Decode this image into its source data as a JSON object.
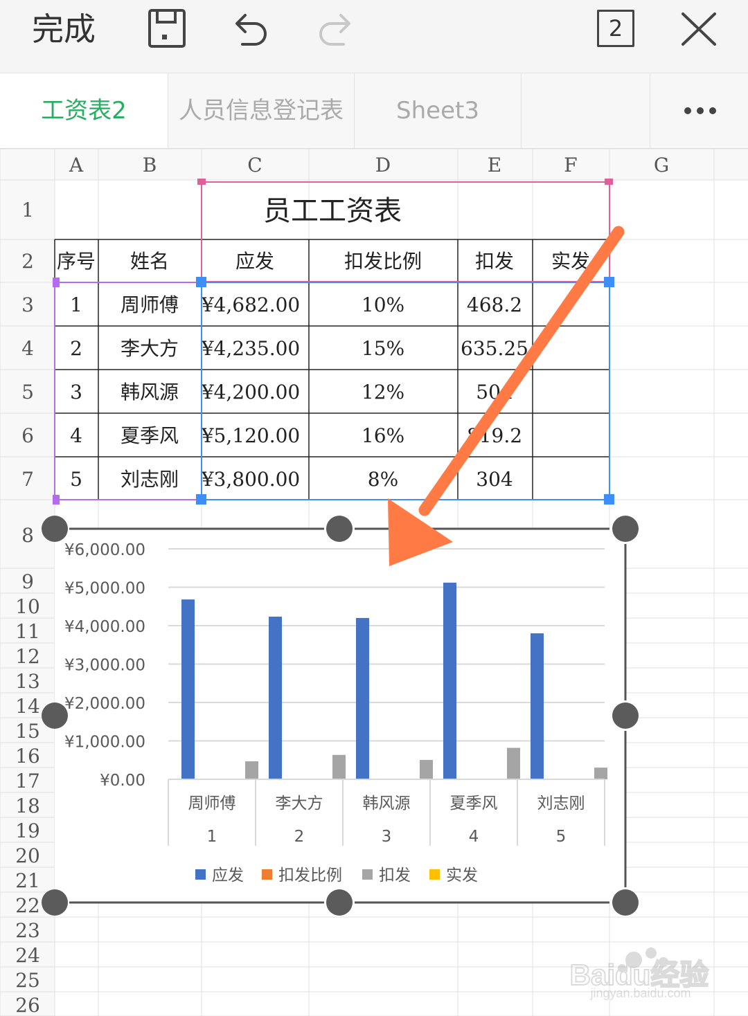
{
  "toolbar": {
    "done_label": "完成",
    "sheet_count": "2"
  },
  "tabs": [
    {
      "label": "工资表2",
      "active": true
    },
    {
      "label": "人员信息登记表",
      "active": false
    },
    {
      "label": "Sheet3",
      "active": false
    }
  ],
  "more_label": "•••",
  "columns": [
    "A",
    "B",
    "C",
    "D",
    "E",
    "F",
    "G"
  ],
  "rows": [
    "1",
    "2",
    "3",
    "4",
    "5",
    "6",
    "7",
    "8",
    "9",
    "10",
    "11",
    "12",
    "13",
    "14",
    "15",
    "16",
    "17",
    "18",
    "19",
    "20",
    "21",
    "22",
    "23",
    "24",
    "25",
    "26"
  ],
  "table": {
    "title": "员工工资表",
    "headers": [
      "序号",
      "姓名",
      "应发",
      "扣发比例",
      "扣发",
      "实发"
    ],
    "records": [
      [
        "1",
        "周师傅",
        "¥4,682.00",
        "10%",
        "468.2",
        ""
      ],
      [
        "2",
        "李大方",
        "¥4,235.00",
        "15%",
        "635.25",
        ""
      ],
      [
        "3",
        "韩风源",
        "¥4,200.00",
        "12%",
        "504",
        ""
      ],
      [
        "4",
        "夏季风",
        "¥5,120.00",
        "16%",
        "819.2",
        ""
      ],
      [
        "5",
        "刘志刚",
        "¥3,800.00",
        "8%",
        "304",
        ""
      ]
    ]
  },
  "chart_data": {
    "type": "bar",
    "title": "",
    "categories": [
      "周师傅",
      "李大方",
      "韩风源",
      "夏季风",
      "刘志刚"
    ],
    "category_sublabels": [
      "1",
      "2",
      "3",
      "4",
      "5"
    ],
    "series": [
      {
        "name": "应发",
        "color": "#4472c4",
        "values": [
          4682,
          4235,
          4200,
          5120,
          3800
        ]
      },
      {
        "name": "扣发比例",
        "color": "#ed7d31",
        "values": [
          0.1,
          0.15,
          0.12,
          0.16,
          0.08
        ]
      },
      {
        "name": "扣发",
        "color": "#a5a5a5",
        "values": [
          468.2,
          635.25,
          504,
          819.2,
          304
        ]
      },
      {
        "name": "实发",
        "color": "#ffc000",
        "values": [
          0,
          0,
          0,
          0,
          0
        ]
      }
    ],
    "y_ticks": [
      "¥0.00",
      "¥1,000.00",
      "¥2,000.00",
      "¥3,000.00",
      "¥4,000.00",
      "¥5,000.00",
      "¥6,000.00"
    ],
    "ylim": [
      0,
      6000
    ],
    "grid": true,
    "legend_position": "bottom"
  },
  "watermark": {
    "brand": "Baidu经验",
    "url": "jingyan.baidu.com"
  },
  "colors": {
    "accent_green": "#27ae60",
    "arrow_orange": "#ff7a45",
    "selection_blue": "#3d8ff7",
    "selection_pink": "#e0609a",
    "selection_purple": "#b36cf0"
  }
}
